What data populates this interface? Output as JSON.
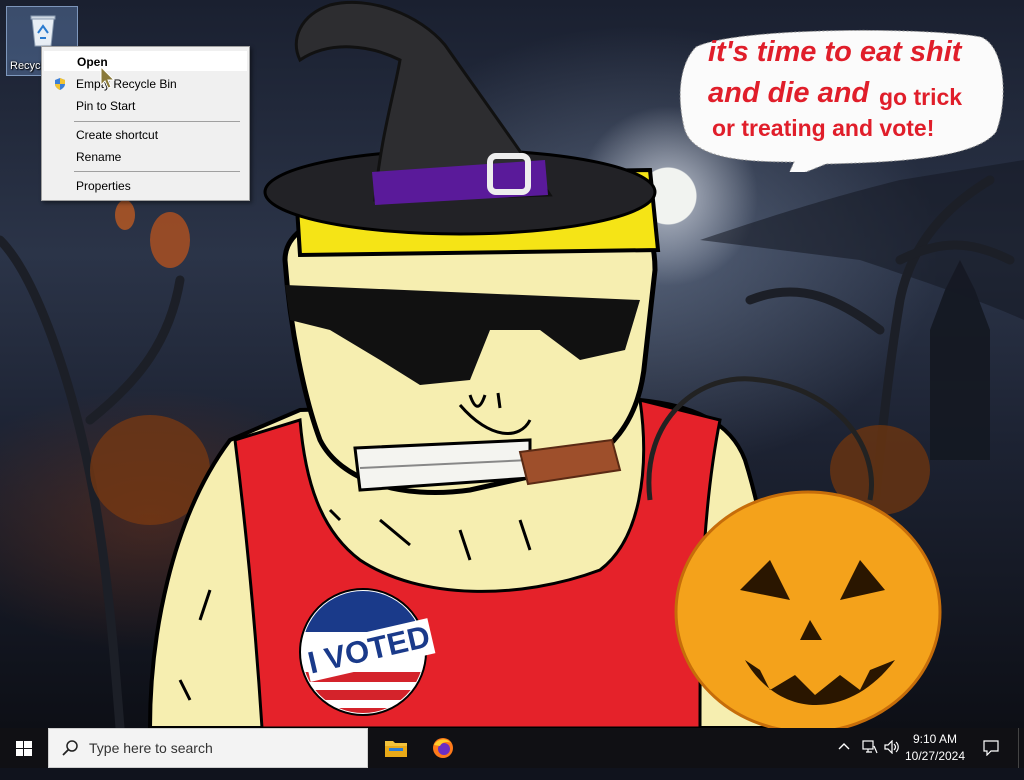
{
  "desktop": {
    "recycle_bin_label": "Recycle Bin"
  },
  "context_menu": {
    "items": [
      {
        "label": "Open",
        "selected": true
      },
      {
        "label": "Empty Recycle Bin"
      },
      {
        "label": "Pin to Start"
      },
      {
        "label": "Create shortcut"
      },
      {
        "label": "Rename"
      },
      {
        "label": "Properties"
      }
    ]
  },
  "wallpaper": {
    "bubble_line1": "it's time to eat shit",
    "bubble_line2a": "and die and",
    "bubble_line2b": "go trick",
    "bubble_line3": "or treating and vote!",
    "badge_text": "I VOTED",
    "colors": {
      "bubble_text": "#e01e2a",
      "shirt": "#e5222a",
      "skin": "#f6eeb0",
      "pumpkin": "#f4a21b"
    }
  },
  "taskbar": {
    "search_placeholder": "Type here to search",
    "apps": [
      "file-explorer-icon",
      "firefox-icon"
    ],
    "clock_time": "9:10 AM",
    "clock_date": "10/27/2024"
  }
}
